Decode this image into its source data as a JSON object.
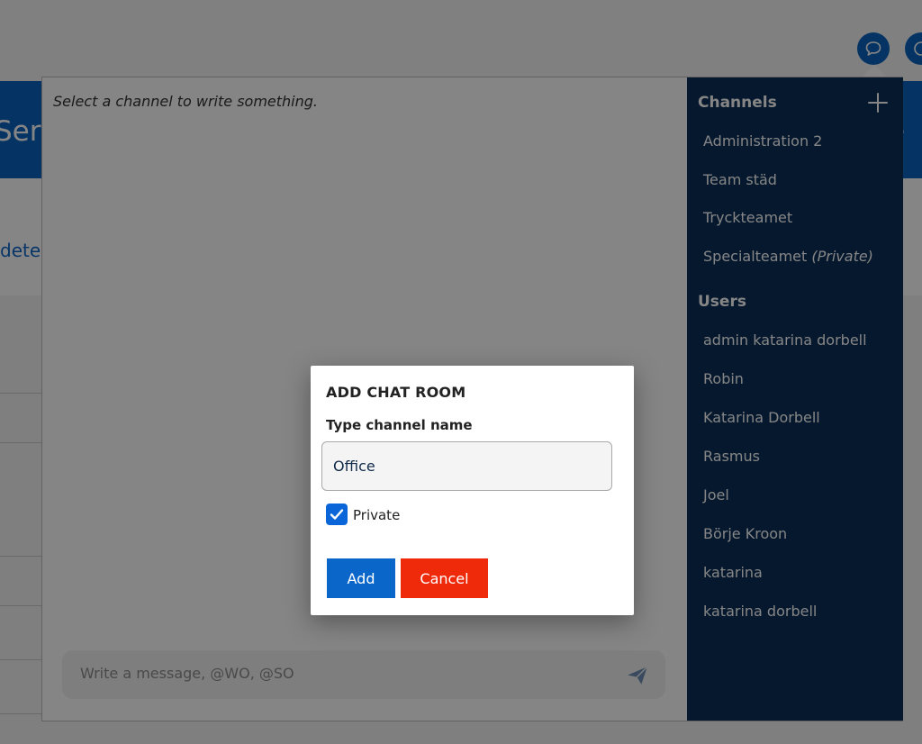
{
  "background": {
    "banner_left_text": "Serv",
    "banner_right_text": "e",
    "link_text": "dete"
  },
  "chat": {
    "hint": "Select a channel to write something.",
    "composer_placeholder": "Write a message, @WO, @SO",
    "sidebar": {
      "channels_heading": "Channels",
      "channels": [
        {
          "name": "Administration 2",
          "private_tag": ""
        },
        {
          "name": "Team städ",
          "private_tag": ""
        },
        {
          "name": "Tryckteamet",
          "private_tag": ""
        },
        {
          "name": "Specialteamet",
          "private_tag": "(Private)"
        }
      ],
      "users_heading": "Users",
      "users": [
        "admin katarina dorbell",
        "Robin",
        "Katarina Dorbell",
        "Rasmus",
        "Joel",
        "Börje Kroon",
        "katarina",
        "katarina dorbell"
      ]
    }
  },
  "modal": {
    "title": "ADD CHAT ROOM",
    "field_label": "Type channel name",
    "field_value": "Office",
    "private_label": "Private",
    "private_checked": true,
    "add_label": "Add",
    "cancel_label": "Cancel"
  },
  "icons": {
    "chat_bubble": "chat-bubble-icon",
    "send": "send-icon",
    "plus": "plus-icon",
    "check": "checkmark-icon"
  },
  "colors": {
    "brand_blue": "#0a64c0",
    "sidebar_navy": "#0a2e58",
    "cancel_red": "#ee2a0a",
    "checkbox_blue": "#0a66d8"
  }
}
